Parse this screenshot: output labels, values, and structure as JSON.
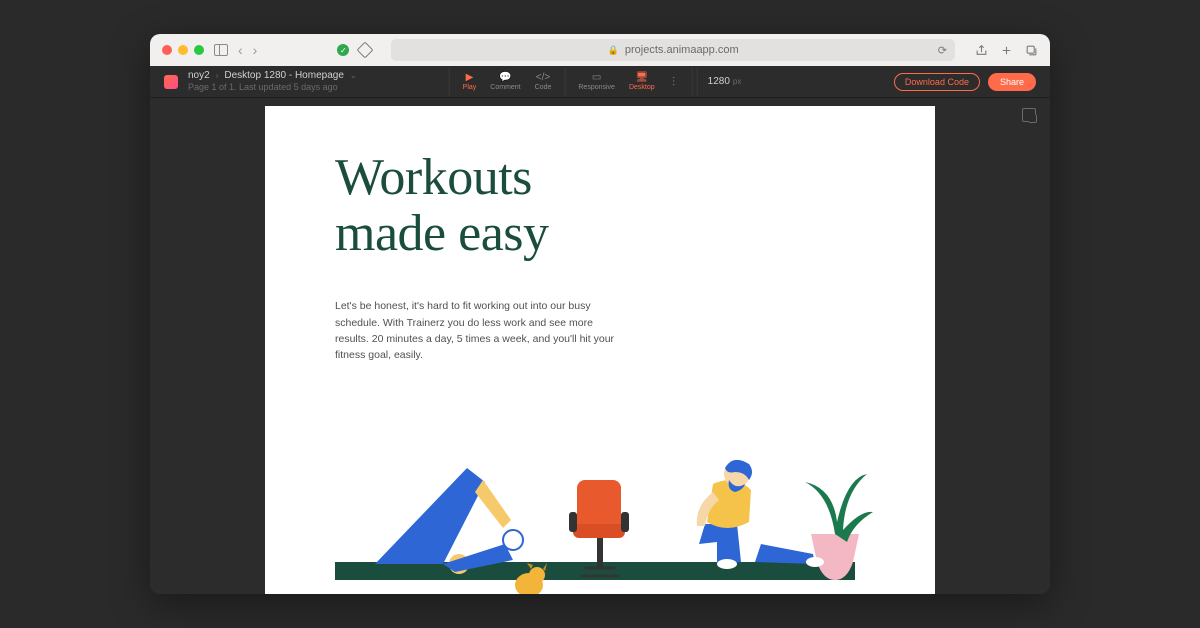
{
  "browser": {
    "url": "projects.animaapp.com",
    "nav_back": "‹",
    "nav_forward": "›"
  },
  "appbar": {
    "project": "noy2",
    "page_name": "Desktop 1280 - Homepage",
    "subtitle": "Page 1 of 1. Last updated 5 days ago",
    "tools": {
      "play": "Play",
      "comment": "Comment",
      "code": "Code",
      "responsive": "Responsive",
      "desktop": "Desktop"
    },
    "viewport_width": "1280",
    "viewport_unit": "px",
    "download": "Download Code",
    "share": "Share"
  },
  "page": {
    "headline_line1": "Workouts",
    "headline_line2": "made easy",
    "body": "Let's be honest, it's hard to fit working out into our busy schedule. With Trainerz you do less work and see more results. 20 minutes a day, 5 times a week, and you'll hit your fitness goal, easily."
  },
  "colors": {
    "accent": "#ff6b4a",
    "headline": "#1b4d3e"
  }
}
